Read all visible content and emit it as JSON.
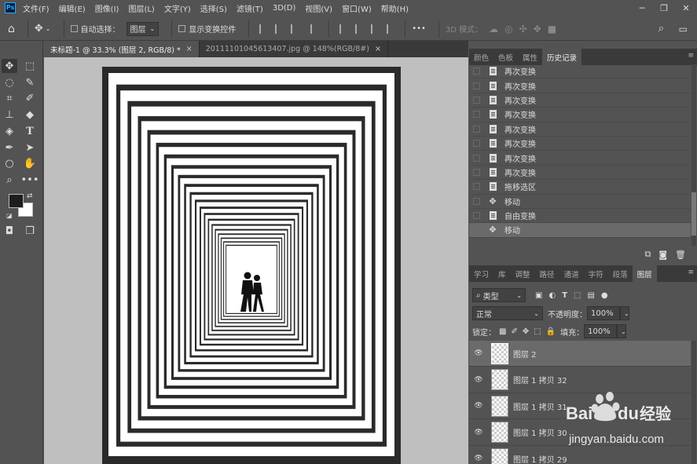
{
  "menubar": {
    "app_logo": "Ps",
    "items": [
      "文件(F)",
      "编辑(E)",
      "图像(I)",
      "图层(L)",
      "文字(Y)",
      "选择(S)",
      "滤镜(T)",
      "3D(D)",
      "视图(V)",
      "窗口(W)",
      "帮助(H)"
    ]
  },
  "optionsbar": {
    "auto_select_label": "自动选择：",
    "auto_select_target": "图层",
    "show_transform_label": "显示变换控件",
    "more_label": "•••",
    "mode_3d_label": "3D 模式："
  },
  "document_tabs": [
    {
      "label": "未标题-1 @ 33.3% (图层 2, RGB/8) *",
      "close": "×"
    },
    {
      "label": "20111101045613407.jpg @ 148%(RGB/8#)",
      "close": "×"
    }
  ],
  "history_panel": {
    "tabs": [
      "颜色",
      "色板",
      "属性",
      "历史记录"
    ],
    "active_tab": "历史记录",
    "items": [
      {
        "label": "再次变换",
        "icon": "doc-icon"
      },
      {
        "label": "再次变换",
        "icon": "doc-icon"
      },
      {
        "label": "再次变换",
        "icon": "doc-icon"
      },
      {
        "label": "再次变换",
        "icon": "doc-icon"
      },
      {
        "label": "再次变换",
        "icon": "doc-icon"
      },
      {
        "label": "再次变换",
        "icon": "doc-icon"
      },
      {
        "label": "再次变换",
        "icon": "doc-icon"
      },
      {
        "label": "再次变换",
        "icon": "doc-icon"
      },
      {
        "label": "拖移选区",
        "icon": "doc-icon"
      },
      {
        "label": "移动",
        "icon": "move-icon"
      },
      {
        "label": "自由变换",
        "icon": "doc-icon"
      },
      {
        "label": "移动",
        "icon": "move-icon"
      }
    ]
  },
  "layers_panel": {
    "tabs": [
      "学习",
      "库",
      "调整",
      "路径",
      "通道",
      "字符",
      "段落",
      "图层"
    ],
    "active_tab": "图层",
    "filter_kind": "类型",
    "blend_mode": "正常",
    "opacity_label": "不透明度：",
    "opacity_value": "100%",
    "lock_label": "锁定：",
    "fill_label": "填充：",
    "fill_value": "100%",
    "layers": [
      {
        "name": "图层 2",
        "selected": true
      },
      {
        "name": "图层 1 拷贝 32",
        "selected": false
      },
      {
        "name": "图层 1 拷贝 31",
        "selected": false
      },
      {
        "name": "图层 1 拷贝 30",
        "selected": false
      },
      {
        "name": "图层 1 拷贝 29",
        "selected": false
      }
    ]
  },
  "watermark": {
    "brand_a": "Bai",
    "brand_b": "du",
    "brand_c": "经验",
    "url": "jingyan.baidu.com"
  }
}
